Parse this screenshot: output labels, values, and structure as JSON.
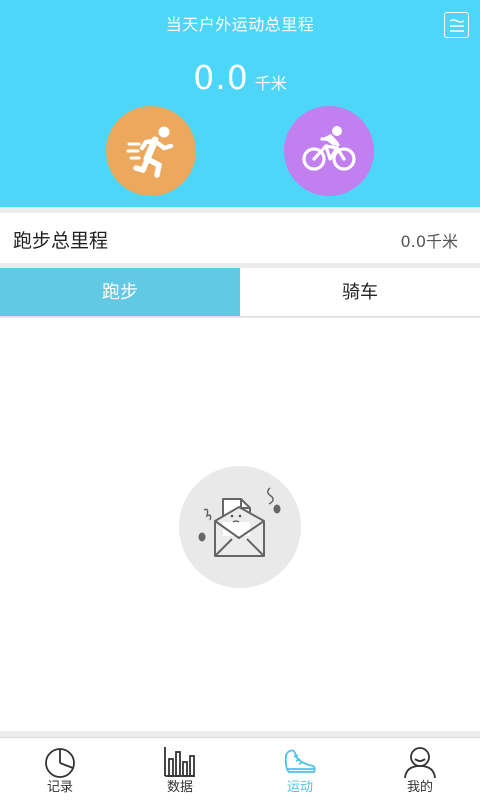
{
  "header": {
    "title": "当天户外运动总里程",
    "total_value": "0.0",
    "total_unit": "千米",
    "background_color": "#4dd6f7",
    "menu_icon": "menu-list-icon",
    "run_button_icon": "running-person-icon",
    "run_button_color": "#eca85c",
    "bike_button_icon": "cyclist-icon",
    "bike_button_color": "#c27ff0"
  },
  "summary": {
    "label": "跑步总里程",
    "value": "0.0千米"
  },
  "tabs": [
    {
      "label": "跑步",
      "active": true
    },
    {
      "label": "骑车",
      "active": false
    }
  ],
  "empty_state": {
    "icon": "empty-envelope-icon"
  },
  "tabbar": {
    "active_color": "#4fc3e8",
    "items": [
      {
        "label": "记录",
        "icon": "pie-chart-icon",
        "active": false
      },
      {
        "label": "数据",
        "icon": "bar-chart-icon",
        "active": false
      },
      {
        "label": "运动",
        "icon": "sneaker-icon",
        "active": true
      },
      {
        "label": "我的",
        "icon": "user-profile-icon",
        "active": false
      }
    ]
  }
}
